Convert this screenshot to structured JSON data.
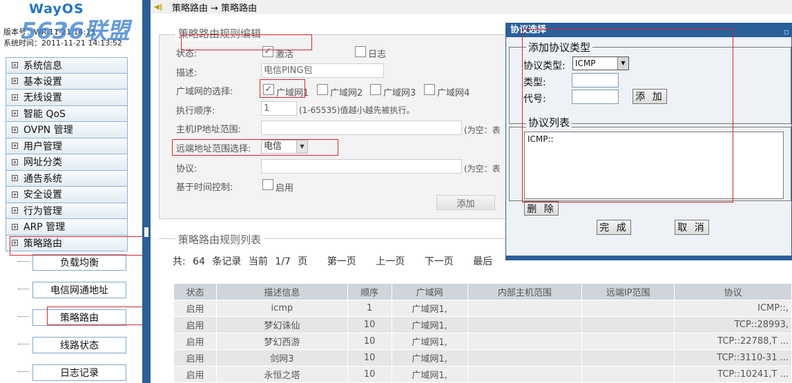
{
  "sidebar": {
    "logo": "WayOS",
    "watermark": "5636联盟",
    "version_text": "版本号：WR-11-21 14:13",
    "system_time": "系统时间：2011-11-21 14:13:52",
    "menu": [
      {
        "label": "系统信息",
        "active": false
      },
      {
        "label": "基本设置",
        "active": false
      },
      {
        "label": "无线设置",
        "active": false
      },
      {
        "label": "智能 QoS",
        "active": false
      },
      {
        "label": "OVPN 管理",
        "active": false
      },
      {
        "label": "用户管理",
        "active": false
      },
      {
        "label": "网址分类",
        "active": false
      },
      {
        "label": "通告系统",
        "active": false
      },
      {
        "label": "安全设置",
        "active": false
      },
      {
        "label": "行为管理",
        "active": false
      },
      {
        "label": "ARP 管理",
        "active": false
      },
      {
        "label": "策略路由",
        "active": true
      }
    ],
    "submenu": [
      {
        "label": "负载均衡"
      },
      {
        "label": "电信网通地址"
      },
      {
        "label": "策略路由"
      },
      {
        "label": "线路状态"
      },
      {
        "label": "日志记录"
      }
    ]
  },
  "breadcrumb": "策略路由 → 策略路由",
  "edit": {
    "legend": "策略路由规则编辑",
    "status_label": "状态:",
    "activate_label": "激活",
    "log_label": "日志",
    "desc_label": "描述:",
    "desc_value": "电信PING包",
    "wan_label": "广域网的选择:",
    "wan_options": [
      "广域网1",
      "广域网2",
      "广域网3",
      "广域网4"
    ],
    "order_label": "执行顺序:",
    "order_value": "1",
    "order_hint": "(1-65535)值越小越先被执行。",
    "host_label": "主机IP地址范围:",
    "host_hint": "(为空：表",
    "remote_label": "远端地址范围选择:",
    "remote_value": "电信",
    "proto_label": "协议:",
    "proto_hint": "(为空：表",
    "time_label": "基于时间控制:",
    "enable_label": "启用",
    "add_button": "添加"
  },
  "list": {
    "legend": "策略路由规则列表",
    "pager": {
      "total": "共: 64 条记录 当前 1/7 页",
      "first": "第一页",
      "prev": "上一页",
      "next": "下一页",
      "last": "最后"
    },
    "headers": [
      "状态",
      "描述信息",
      "顺序",
      "广域网",
      "内部主机范围",
      "远端IP范围",
      "协议"
    ],
    "rows": [
      [
        "启用",
        "icmp",
        "1",
        "广域网1,",
        "",
        "",
        "ICMP::,"
      ],
      [
        "启用",
        "梦幻诛仙",
        "10",
        "广域网1,",
        "",
        "",
        "TCP::28993,"
      ],
      [
        "启用",
        "梦幻西游",
        "10",
        "广域网1,",
        "",
        "",
        "TCP::22788,T ..."
      ],
      [
        "启用",
        "剑网3",
        "10",
        "广域网1,",
        "",
        "",
        "TCP::3110-31 ..."
      ],
      [
        "启用",
        "永恒之塔",
        "10",
        "广域网1,",
        "",
        "",
        "TCP::10241,T ..."
      ]
    ]
  },
  "dialog": {
    "title": "协议选择",
    "add_legend": "添加协议类型",
    "proto_type_label": "协议类型:",
    "proto_type_value": "ICMP",
    "type_label": "类型:",
    "code_label": "代号:",
    "add_button": "添 加",
    "list_legend": "协议列表",
    "list_items": [
      "ICMP::"
    ],
    "delete_button": "删 除",
    "done_button": "完 成",
    "cancel_button": "取 消"
  },
  "colors": {
    "accent": "#2a5f9b",
    "annotation": "#d9252a"
  }
}
